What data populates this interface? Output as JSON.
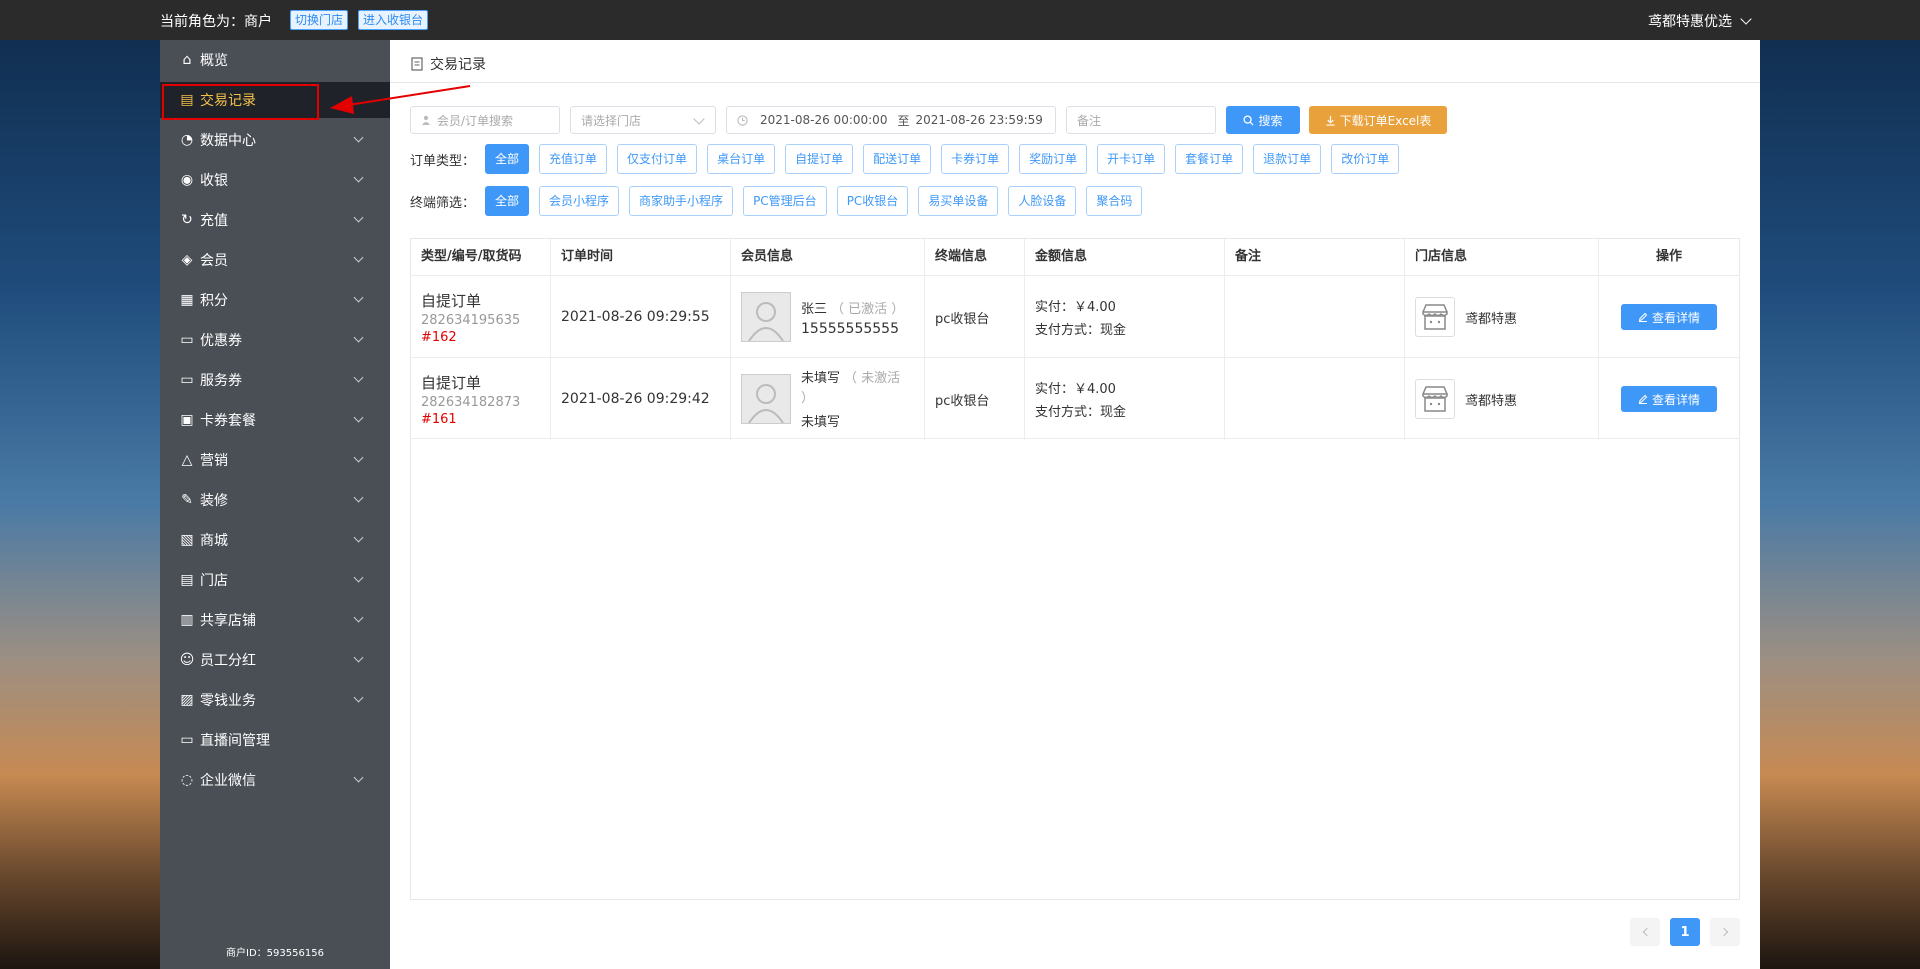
{
  "topbar": {
    "role": "当前角色为：商户",
    "switch_store": "切换门店",
    "enter_cashier": "进入收银台",
    "shop_name": "鸢都特惠优选"
  },
  "sidebar": {
    "items": [
      {
        "label": "概览",
        "icon": "home-icon",
        "arrow": false
      },
      {
        "label": "交易记录",
        "icon": "record-icon",
        "arrow": false,
        "active": true
      },
      {
        "label": "数据中心",
        "icon": "chart-icon",
        "arrow": true
      },
      {
        "label": "收银",
        "icon": "cashier-icon",
        "arrow": true
      },
      {
        "label": "充值",
        "icon": "recharge-icon",
        "arrow": true
      },
      {
        "label": "会员",
        "icon": "member-icon",
        "arrow": true
      },
      {
        "label": "积分",
        "icon": "points-icon",
        "arrow": true
      },
      {
        "label": "优惠券",
        "icon": "coupon-icon",
        "arrow": true
      },
      {
        "label": "服务券",
        "icon": "service-coupon-icon",
        "arrow": true
      },
      {
        "label": "卡券套餐",
        "icon": "card-package-icon",
        "arrow": true
      },
      {
        "label": "营销",
        "icon": "marketing-icon",
        "arrow": true
      },
      {
        "label": "装修",
        "icon": "decorate-icon",
        "arrow": true
      },
      {
        "label": "商城",
        "icon": "mall-icon",
        "arrow": true
      },
      {
        "label": "门店",
        "icon": "store-icon",
        "arrow": true
      },
      {
        "label": "共享店铺",
        "icon": "shared-store-icon",
        "arrow": true
      },
      {
        "label": "员工分红",
        "icon": "staff-bonus-icon",
        "arrow": true
      },
      {
        "label": "零钱业务",
        "icon": "wallet-icon",
        "arrow": true
      },
      {
        "label": "直播间管理",
        "icon": "live-icon",
        "arrow": false
      },
      {
        "label": "企业微信",
        "icon": "wecom-icon",
        "arrow": true
      }
    ],
    "merchant_id": "商户ID：593556156"
  },
  "main": {
    "breadcrumb": "交易记录",
    "search": {
      "member_placeholder": "会员/订单搜索",
      "store_placeholder": "请选择门店",
      "date_start": "2021-08-26 00:00:00",
      "date_sep": "至",
      "date_end": "2021-08-26 23:59:59",
      "note_placeholder": "备注",
      "search_label": "搜索",
      "download_label": "下载订单Excel表"
    },
    "order_type": {
      "label": "订单类型：",
      "options": [
        "全部",
        "充值订单",
        "仅支付订单",
        "桌台订单",
        "自提订单",
        "配送订单",
        "卡券订单",
        "奖励订单",
        "开卡订单",
        "套餐订单",
        "退款订单",
        "改价订单"
      ],
      "selected": "全部"
    },
    "terminal": {
      "label": "终端筛选：",
      "options": [
        "全部",
        "会员小程序",
        "商家助手小程序",
        "PC管理后台",
        "PC收银台",
        "易买单设备",
        "人脸设备",
        "聚合码"
      ],
      "selected": "全部"
    },
    "table": {
      "headers": [
        "类型/编号/取货码",
        "订单时间",
        "会员信息",
        "终端信息",
        "金额信息",
        "备注",
        "门店信息",
        "操作"
      ],
      "rows": [
        {
          "type": "自提订单",
          "number": "282634195635",
          "pickup": "#162",
          "time": "2021-08-26 09:29:55",
          "member_name": "张三",
          "member_status": "（ 已激活 ）",
          "member_phone": "15555555555",
          "terminal": "pc收银台",
          "paid": "实付：￥4.00",
          "pay_method": "支付方式：现金",
          "note": "",
          "store": "鸢都特惠",
          "action": "查看详情"
        },
        {
          "type": "自提订单",
          "number": "282634182873",
          "pickup": "#161",
          "time": "2021-08-26 09:29:42",
          "member_name": "未填写",
          "member_status": "（ 未激活 ）",
          "member_phone": "未填写",
          "terminal": "pc收银台",
          "paid": "实付：￥4.00",
          "pay_method": "支付方式：现金",
          "note": "",
          "store": "鸢都特惠",
          "action": "查看详情"
        }
      ]
    },
    "pagination": {
      "current": "1"
    }
  }
}
